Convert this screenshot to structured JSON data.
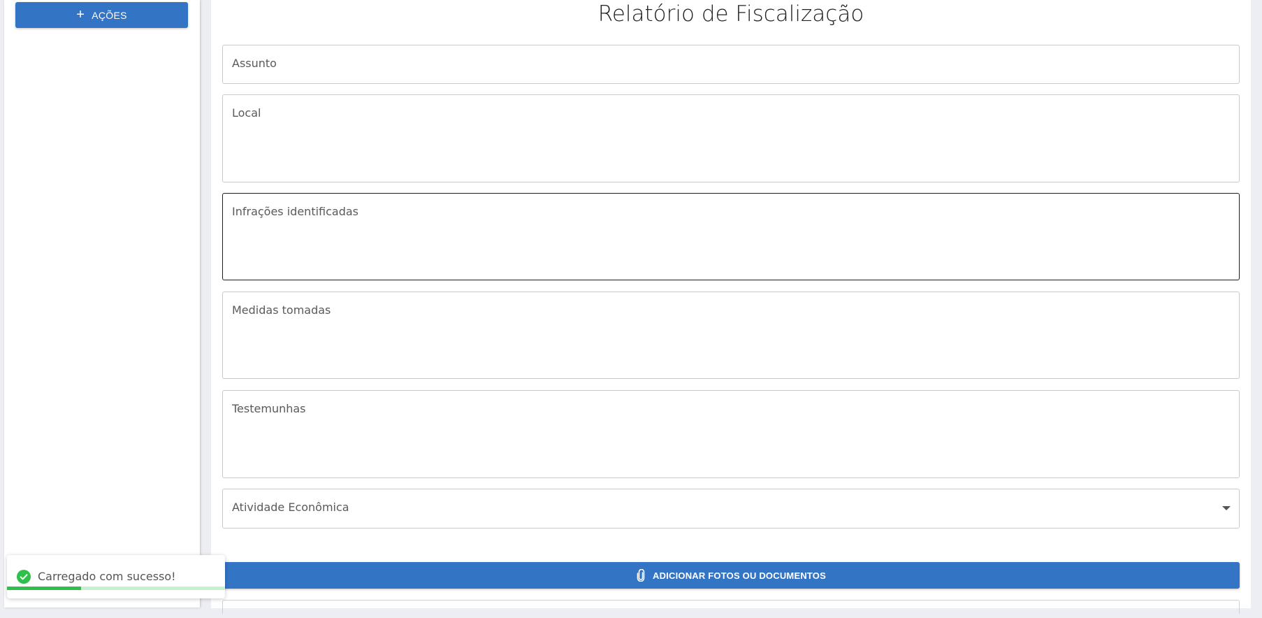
{
  "sidebar": {
    "actions_label": "AÇÕES"
  },
  "form": {
    "title": "Relatório de Fiscalização",
    "fields": {
      "assunto": {
        "label": "Assunto",
        "value": ""
      },
      "local": {
        "label": "Local",
        "value": ""
      },
      "infracoes": {
        "label": "Infrações identificadas",
        "value": ""
      },
      "medidas": {
        "label": "Medidas tomadas",
        "value": ""
      },
      "testemunhas": {
        "label": "Testemunhas",
        "value": ""
      },
      "atividade": {
        "label": "Atividade Econômica",
        "value": ""
      }
    },
    "upload_label": "ADICIONAR FOTOS OU DOCUMENTOS"
  },
  "toast": {
    "message": "Carregado com sucesso!",
    "progress": 0.34
  },
  "colors": {
    "primary": "#3374c4",
    "success": "#2ec04a",
    "success_track": "#c7f0cf",
    "background": "#eceef3"
  },
  "icons": {
    "actions": "plus-icon",
    "upload": "paperclip-icon",
    "toast": "check-circle-icon",
    "select": "caret-down-icon"
  }
}
